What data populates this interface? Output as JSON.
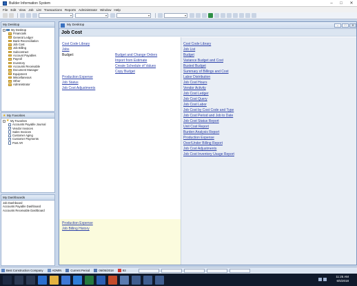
{
  "window": {
    "title": "Builder Information System"
  },
  "menu": [
    "File",
    "Edit",
    "View",
    "Job",
    "List",
    "Transactions",
    "Reports",
    "Administrator",
    "Window",
    "Help"
  ],
  "sidebar": {
    "desktop_header": "My Desktop",
    "desktop_root": "My Desktop",
    "desktop_items": [
      "Financials",
      "General Ledger",
      "Bank Reconciliation",
      "Job Cost",
      "Job Billing",
      "Subcontract",
      "Account Payables",
      "Payroll",
      "Inventory",
      "Accounts Receivable",
      "Document Manager",
      "Equipment",
      "Miscellaneous",
      "Other",
      "Administrator"
    ],
    "favorites_header": "My Favorites",
    "favorites_root": "My Favorites",
    "favorites_items": [
      "Accounts Payable Journal",
      "Vendor Invoices",
      "Sales Invoices",
      "Customer Aging",
      "Customer Payments",
      "Post AR"
    ],
    "dashboards_header": "My Dashboards",
    "dashboards_items": [
      "Job Dashboard",
      "Accounts Payable Dashboard",
      "Accounts Receivable Dashboard"
    ]
  },
  "child_window": {
    "title": "My Desktop",
    "heading": "Job Cost",
    "left_links": {
      "cost_code_library": "Cost Code Library",
      "jobs": "Jobs",
      "budget_label": "Budget:",
      "budget_change_orders": "Budget and Change Orders",
      "import_from_estimate": "Import from Estimate",
      "create_schedule_values": "Create Schedule of Values",
      "copy_budget": "Copy Budget",
      "production_expense": "Production Expense",
      "job_status": "Job Status",
      "job_cost_adjustments": "Job Cost Adjustments"
    },
    "left_bottom_links": [
      "Production Expense",
      "Job Billing History"
    ],
    "reports": [
      "Cost Code Library",
      "Job List",
      "Budget",
      "Variance Budget and Cost",
      "Busted Budget",
      "Summary of Billings and Cost",
      "Labor Distribution",
      "Job Cost Hours",
      "Vendor Activity",
      "Job Cost Ledger",
      "Job Cost Query",
      "Job Cost Labor",
      "Job Cost by Cost Code and Type",
      "Job Cost Period and Job to Date",
      "Job Cost Status Report",
      "Unit Cost Report",
      "Burden Analysis Report",
      "Production Expense",
      "Over/Under Billing Report",
      "Job Cost Adjustments",
      "Job Cost Inventory Usage Report"
    ]
  },
  "statusbar": {
    "company": "Best Construction Company",
    "user": "ADMIN",
    "period_label": "Current Period",
    "period_date": "06/05/2018",
    "number": "93"
  },
  "taskbar": {
    "time": "11:25 AM",
    "date": "6/5/2018"
  }
}
